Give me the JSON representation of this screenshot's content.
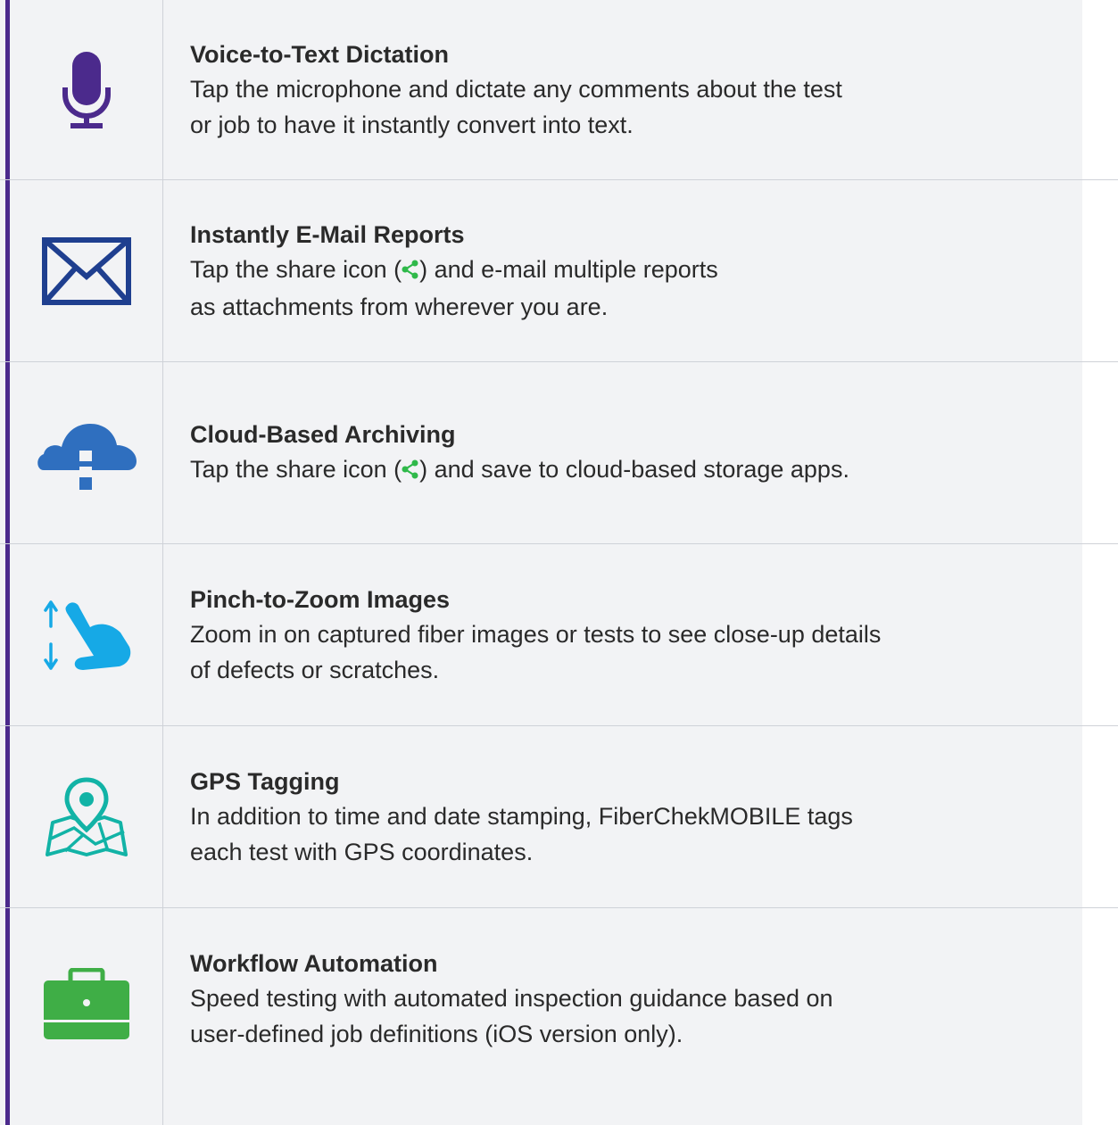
{
  "colors": {
    "accent_bar": "#4b2a8c",
    "panel_bg": "#f2f3f5",
    "divider": "#cfd2d8",
    "share_icon": "#2fb94a"
  },
  "features": [
    {
      "icon": "microphone-icon",
      "icon_color": "#4b2a8c",
      "title": "Voice-to-Text Dictation",
      "lines": [
        "Tap the microphone and dictate any comments about the test",
        "or job to have it instantly convert into text."
      ]
    },
    {
      "icon": "envelope-icon",
      "icon_color": "#1f3f8f",
      "title": "Instantly E-Mail Reports",
      "line1_before": "Tap the share icon (",
      "line1_after": ") and e-mail multiple reports",
      "line2": "as attachments from wherever you are."
    },
    {
      "icon": "cloud-icon",
      "icon_color": "#2f6fbf",
      "title": "Cloud-Based Archiving",
      "line1_before": "Tap the share icon (",
      "line1_after": ") and save to cloud-based storage apps."
    },
    {
      "icon": "pinch-zoom-hand-icon",
      "icon_color": "#16a9e6",
      "title": "Pinch-to-Zoom Images",
      "lines": [
        "Zoom in on captured fiber images or tests to see close-up details",
        "of defects or scratches."
      ]
    },
    {
      "icon": "map-pin-icon",
      "icon_color": "#12b3a6",
      "title": "GPS Tagging",
      "lines": [
        "In addition to time and date stamping, FiberChekMOBILE tags",
        "each test with GPS coordinates."
      ]
    },
    {
      "icon": "briefcase-icon",
      "icon_color": "#3fae46",
      "title": "Workflow Automation",
      "lines": [
        "Speed testing with automated inspection guidance based on",
        "user-defined job definitions (iOS version only)."
      ]
    }
  ]
}
